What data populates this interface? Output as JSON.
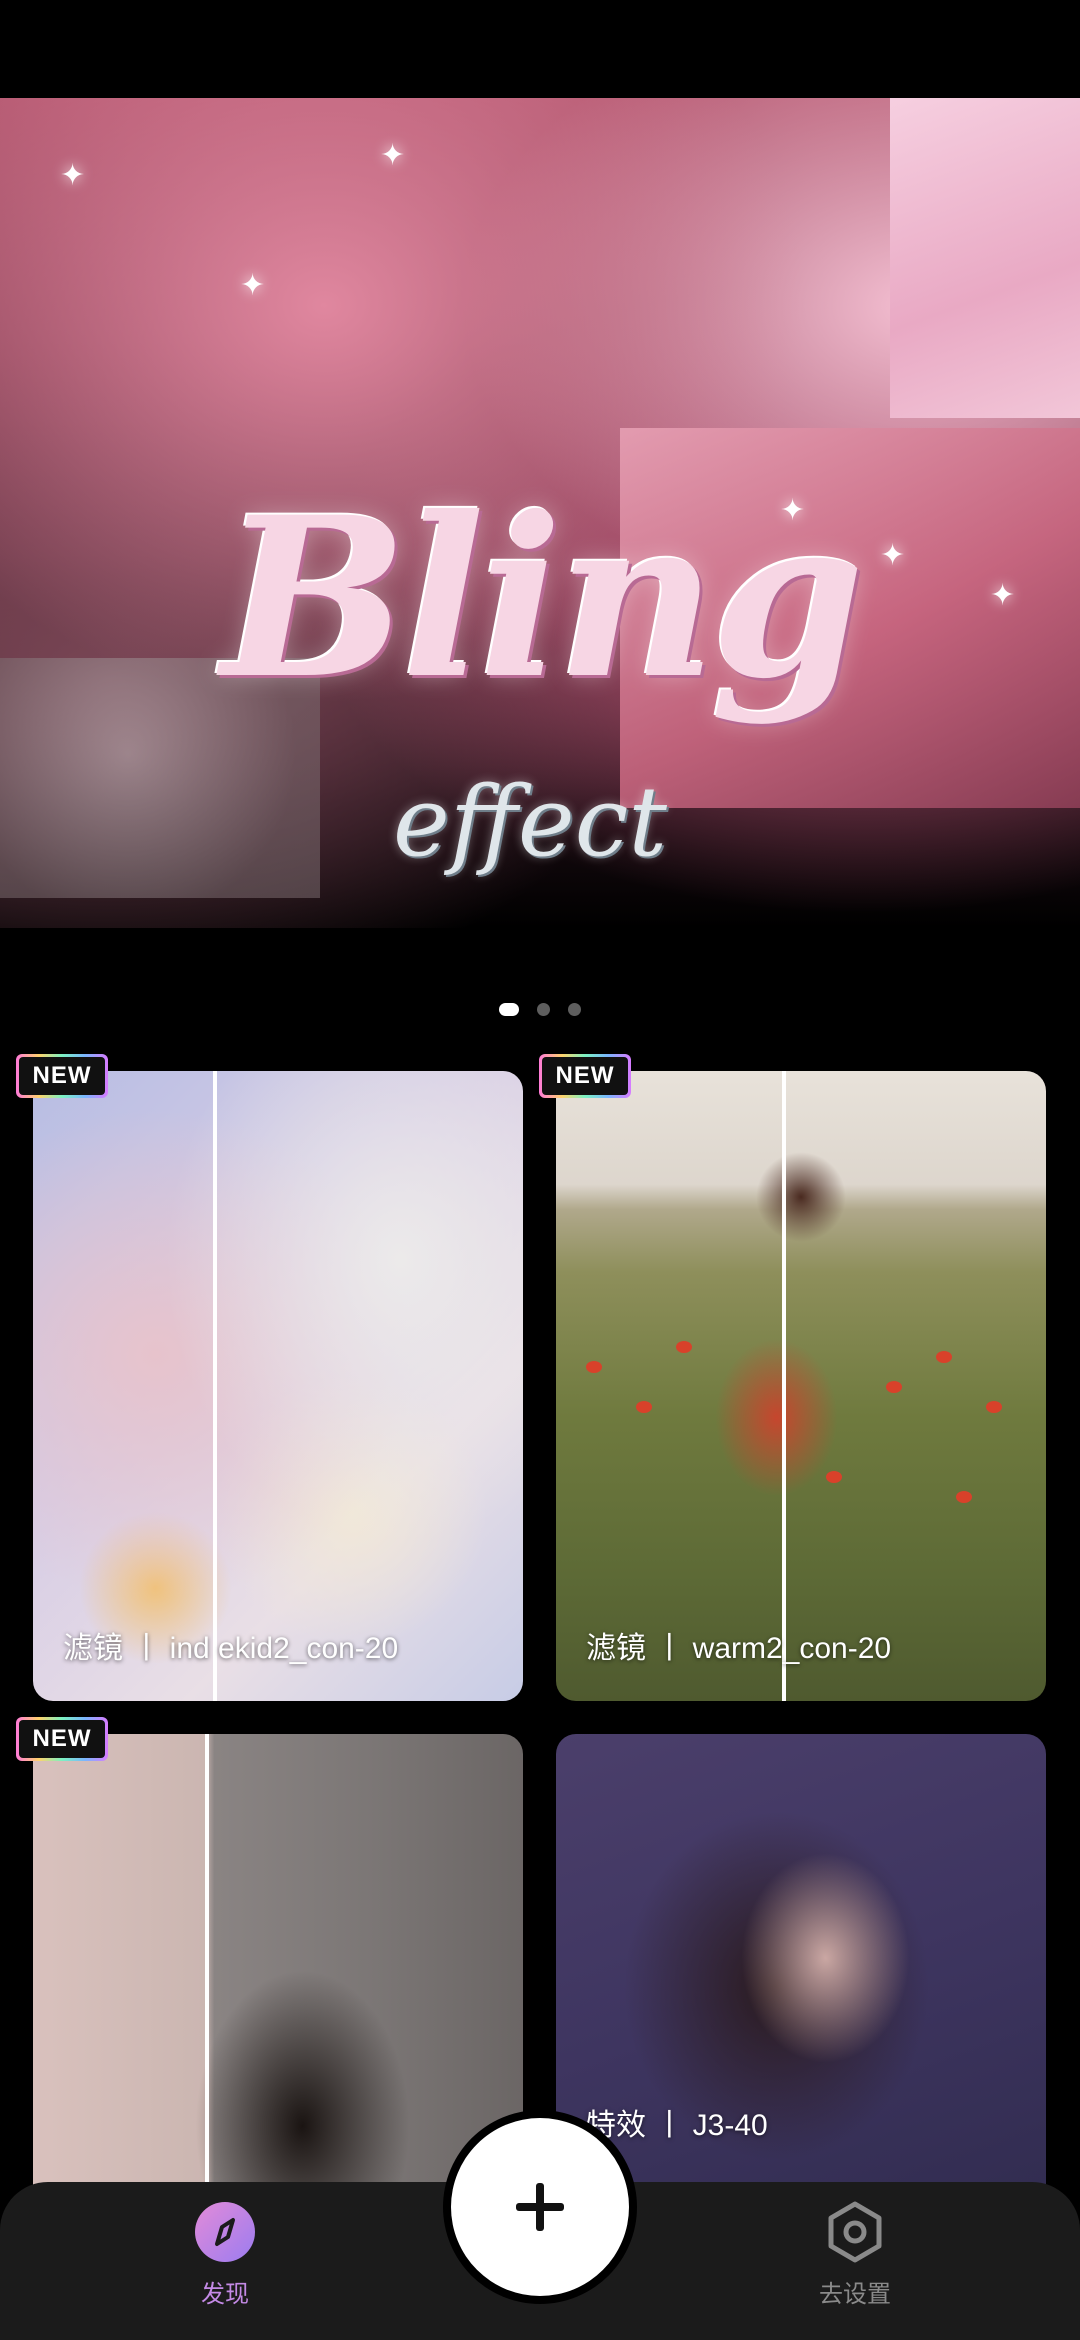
{
  "banner": {
    "title_main": "Bling",
    "title_sub": "effect",
    "page_count": 3,
    "active_page": 1
  },
  "cards": [
    {
      "badge": "NEW",
      "label": "滤镜 丨 ind ekid2_con-20"
    },
    {
      "badge": "NEW",
      "label": "滤镜 丨 warm2_con-20"
    },
    {
      "badge": "NEW",
      "label": ""
    },
    {
      "badge": "",
      "label": "特效 丨 J3-40"
    }
  ],
  "tabbar": {
    "discover_label": "发现",
    "settings_label": "去设置",
    "discover_icon": "compass-icon",
    "settings_icon": "hex-gear-icon",
    "add_icon": "plus-icon",
    "accent_color": "#c48ae6"
  }
}
